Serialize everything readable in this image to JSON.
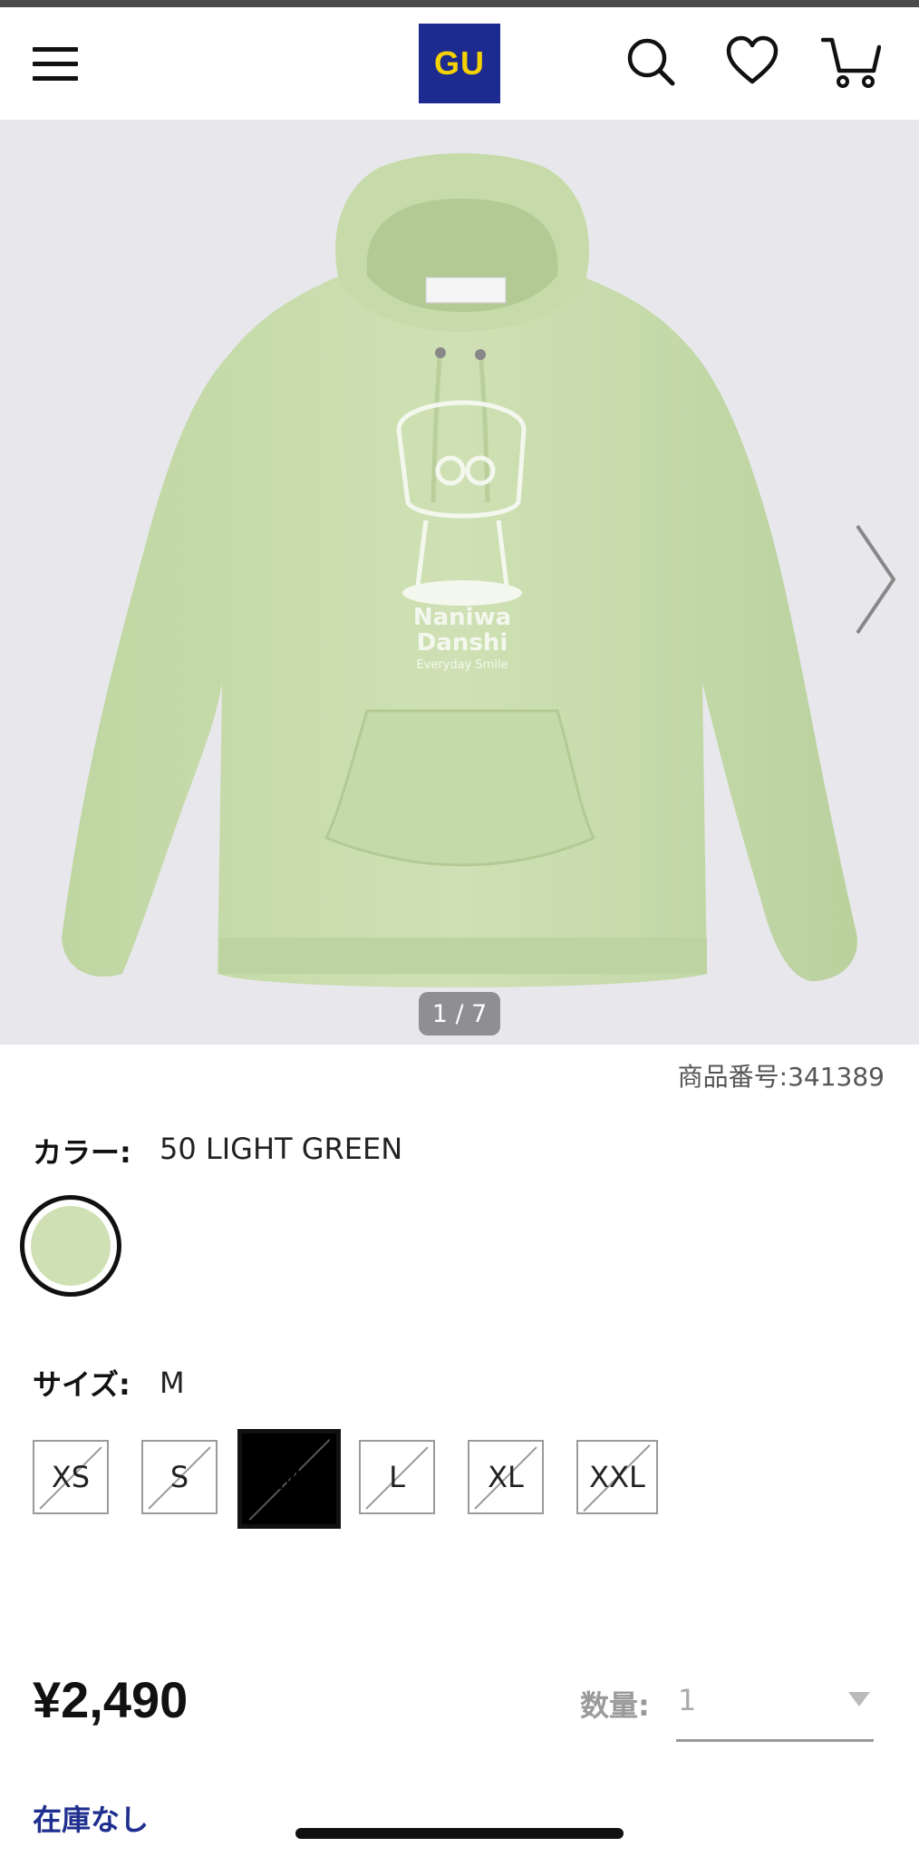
{
  "header": {
    "logo_text": "GU",
    "menu_icon": "hamburger-menu-icon",
    "icons": [
      "search-icon",
      "heart-icon",
      "cart-icon"
    ],
    "logo_bg": "#1d2a8f",
    "logo_fg": "#f4d100"
  },
  "gallery": {
    "counter": "1 / 7",
    "next_icon": "chevron-right-icon"
  },
  "product": {
    "sku": "商品番号:341389",
    "color_label": "カラー:",
    "color_value": "50 LIGHT GREEN",
    "swatch_color": "#cfe1b4",
    "size_label": "サイズ:",
    "size_value": "M",
    "sizes": [
      {
        "label": "XS",
        "selected": false,
        "unavailable": true
      },
      {
        "label": "S",
        "selected": false,
        "unavailable": true
      },
      {
        "label": "M",
        "selected": true,
        "unavailable": true
      },
      {
        "label": "L",
        "selected": false,
        "unavailable": true
      },
      {
        "label": "XL",
        "selected": false,
        "unavailable": true
      },
      {
        "label": "XXL",
        "selected": false,
        "unavailable": true
      }
    ],
    "price": "¥2,490",
    "qty_label": "数量:",
    "qty_value": "1",
    "stock_status": "在庫なし"
  }
}
